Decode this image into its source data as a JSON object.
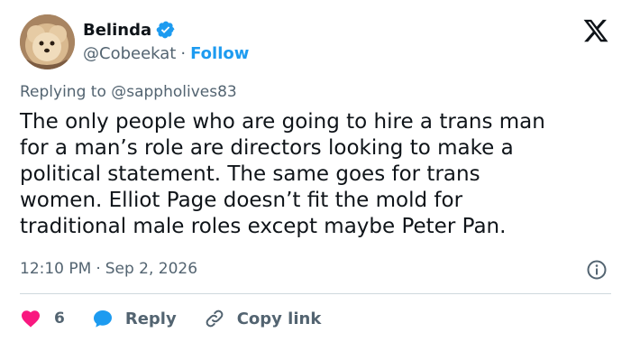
{
  "author": {
    "display_name": "Belinda",
    "handle": "@Cobeekat",
    "separator": "·",
    "follow_label": "Follow"
  },
  "reply_to": "Replying to @sappholives83",
  "tweet": {
    "text": "The only people who are going to hire a trans man\nfor a man’s role are directors looking to make a\npolitical statement. The same goes for trans\nwomen. Elliot Page doesn’t fit the mold for\ntraditional male roles except maybe Peter Pan."
  },
  "meta": {
    "time": "12:10 PM",
    "separator": "·",
    "date": "Sep 2, 2026"
  },
  "actions": {
    "like_count": "6",
    "reply_label": "Reply",
    "copy_label": "Copy link"
  },
  "colors": {
    "accent": "#1d9bf0",
    "like": "#f91880",
    "text": "#0f1419",
    "muted": "#536471"
  },
  "icons": [
    "verified-badge-icon",
    "x-logo-icon",
    "info-icon",
    "heart-icon",
    "reply-bubble-icon",
    "link-icon"
  ]
}
